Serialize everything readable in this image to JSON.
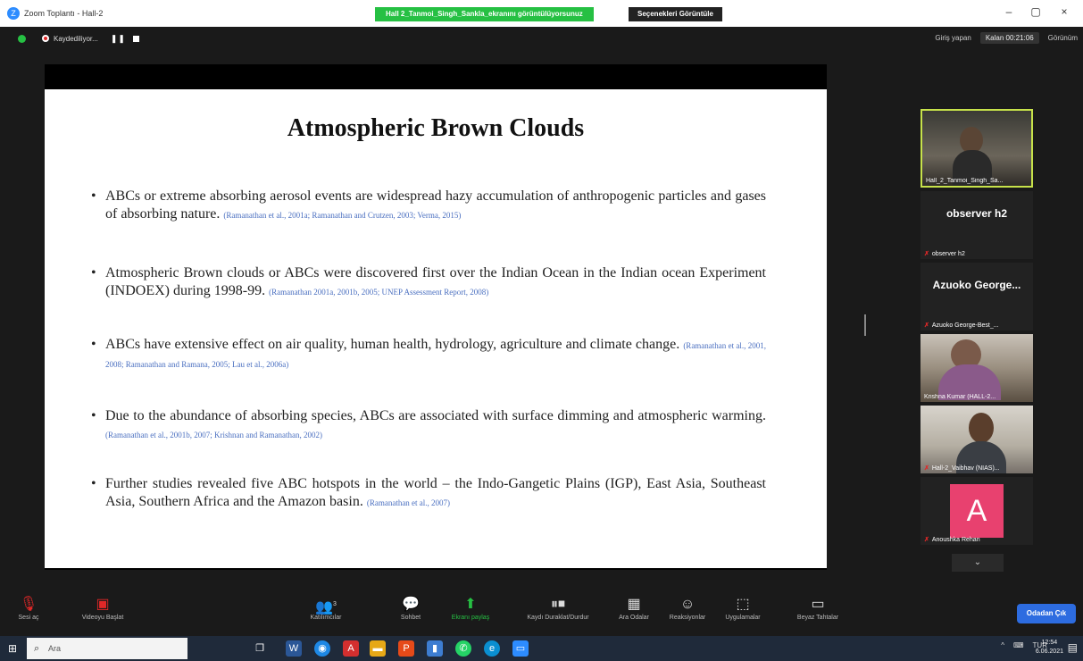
{
  "window": {
    "title": "Zoom Toplantı - Hall-2",
    "share_banner": "Hall 2_Tanmoi_Singh_Sankla_ekranını görüntülüyorsunuz",
    "view_options": "Seçenekleri Görüntüle",
    "minimize": "–",
    "maximize": "▢",
    "close": "×"
  },
  "recording": {
    "label": "Kaydediliyor...",
    "pause_icon": "❚❚"
  },
  "top_right": {
    "speaker_view": "Giriş yapan",
    "timer": "Kalan 00:21:06",
    "gallery": "Görünüm"
  },
  "slide": {
    "title": "Atmospheric Brown Clouds",
    "bullets": [
      {
        "text": "ABCs or extreme absorbing aerosol events are widespread hazy accumulation of anthropogenic particles and gases of absorbing nature.",
        "cite": "(Ramanathan et al., 2001a; Ramanathan and Crutzen, 2003; Verma, 2015)"
      },
      {
        "text": "Atmospheric Brown clouds or ABCs were discovered first over the Indian Ocean in the Indian ocean Experiment (INDOEX) during 1998-99.",
        "cite": "(Ramanathan 2001a, 2001b, 2005; UNEP Assessment Report, 2008)"
      },
      {
        "text": "ABCs have extensive effect on air quality, human health, hydrology, agriculture and climate change.",
        "cite": "(Ramanathan et al., 2001, 2008; Ramanathan and Ramana, 2005; Lau et al., 2006a)"
      },
      {
        "text": "Due to the abundance of absorbing species, ABCs are associated with surface dimming and atmospheric warming.",
        "cite": "(Ramanathan et al., 2001b, 2007; Krishnan and Ramanathan, 2002)"
      },
      {
        "text": "Further studies revealed five ABC hotspots in the world – the Indo-Gangetic Plains (IGP), East Asia, Southeast Asia, Southern Africa and the Amazon basin.",
        "cite": "(Ramanathan et al., 2007)"
      }
    ]
  },
  "participants": [
    {
      "name": "Hall_2_Tanmoi_Singh_Sa...",
      "type": "video"
    },
    {
      "big_name": "observer h2",
      "name": "observer h2",
      "type": "name"
    },
    {
      "big_name": "Azuoko George...",
      "name": "Azuoko George-Best_...",
      "type": "name"
    },
    {
      "name": "Krishna Kumar (HALL-2...",
      "type": "video"
    },
    {
      "name": "Hall-2_Vaibhav (NIAS)...",
      "type": "video"
    },
    {
      "avatar_letter": "A",
      "name": "Anoushka Rehan",
      "type": "avatar"
    }
  ],
  "scroll_down": "⌄",
  "toolbar": {
    "mute": "Sesi aç",
    "video": "Videoyu Başlat",
    "participants": "Katılımcılar",
    "participants_count": "3",
    "chat": "Sohbet",
    "share": "Ekranı paylaş",
    "pause_share": "Kaydı Duraklat/Durdur",
    "breakout": "Ara Odalar",
    "reactions": "Reaksiyonlar",
    "apps": "Uygulamalar",
    "whiteboard": "Beyaz Tahtalar",
    "leave": "Odadan Çık"
  },
  "taskbar": {
    "search_placeholder": "Ara",
    "lang": "TUR",
    "time": "12:54",
    "date": "6.06.2021"
  },
  "colors": {
    "share_green": "#26c043",
    "accent_blue": "#2d6ce0",
    "active_speaker": "#c7e24a",
    "avatar_pink": "#e8416f"
  }
}
